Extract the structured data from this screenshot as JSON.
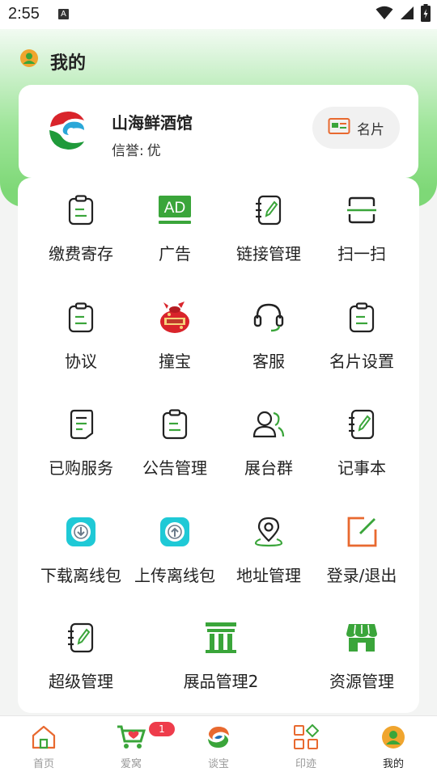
{
  "status_bar": {
    "time": "2:55",
    "notification_glyph": "A"
  },
  "header": {
    "title": "我的"
  },
  "profile": {
    "shop_name": "山海鲜酒馆",
    "credit_label": "信誉:",
    "credit_value": "优",
    "card_button_label": "名片"
  },
  "menu": {
    "items": [
      {
        "label": "缴费寄存",
        "icon": "clipboard-icon"
      },
      {
        "label": "广告",
        "icon": "ad-icon"
      },
      {
        "label": "链接管理",
        "icon": "notebook-pen-icon"
      },
      {
        "label": "扫一扫",
        "icon": "scan-icon"
      },
      {
        "label": "协议",
        "icon": "clipboard-icon"
      },
      {
        "label": "撞宝",
        "icon": "treasure-bag-icon"
      },
      {
        "label": "客服",
        "icon": "headset-icon"
      },
      {
        "label": "名片设置",
        "icon": "clipboard-icon"
      },
      {
        "label": "已购服务",
        "icon": "document-icon"
      },
      {
        "label": "公告管理",
        "icon": "clipboard-icon"
      },
      {
        "label": "展台群",
        "icon": "users-icon"
      },
      {
        "label": "记事本",
        "icon": "notebook-pen-icon"
      },
      {
        "label": "下载离线包",
        "icon": "download-icon"
      },
      {
        "label": "上传离线包",
        "icon": "upload-icon"
      },
      {
        "label": "地址管理",
        "icon": "location-pin-icon"
      },
      {
        "label": "登录/退出",
        "icon": "edit-square-icon"
      },
      {
        "label": "超级管理",
        "icon": "notebook-pen-icon"
      },
      {
        "label": "展品管理2",
        "icon": "booth-icon"
      },
      {
        "label": "资源管理",
        "icon": "store-icon"
      }
    ],
    "ad_text": "AD"
  },
  "tabbar": {
    "tabs": [
      {
        "label": "首页",
        "icon": "home-icon"
      },
      {
        "label": "爱窝",
        "icon": "cart-heart-icon",
        "badge": "1"
      },
      {
        "label": "谈宝",
        "icon": "swirl-logo-icon"
      },
      {
        "label": "印迹",
        "icon": "grid-icon"
      },
      {
        "label": "我的",
        "icon": "profile-icon"
      }
    ],
    "active_index": 4
  },
  "colors": {
    "accent_green": "#3aa53a",
    "badge_red": "#ee3c4b",
    "orange": "#e8692f",
    "cyan": "#1fc9d6"
  }
}
